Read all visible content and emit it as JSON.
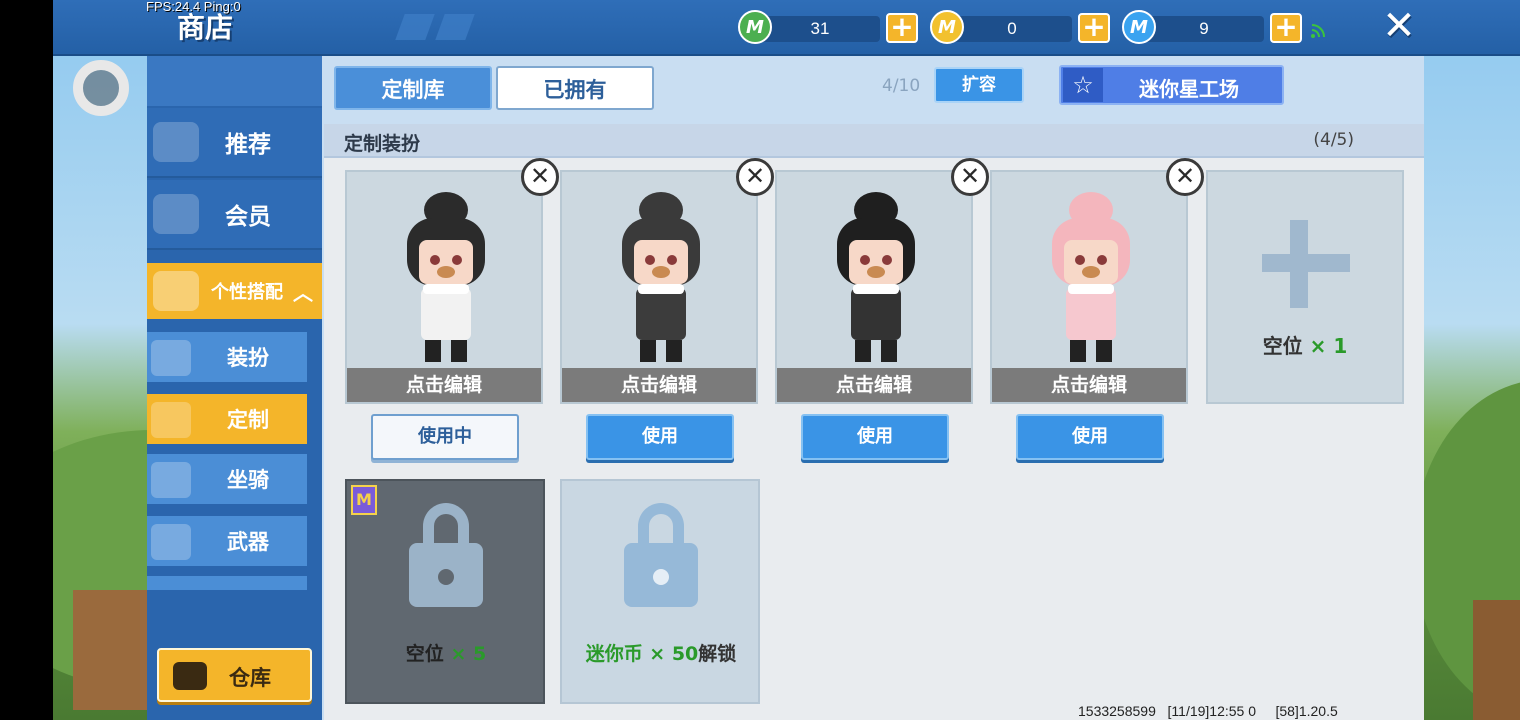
{
  "hud": {
    "fps": "FPS:24.4  Ping:0",
    "title": "商店"
  },
  "currencies": [
    {
      "icon": "green-gem-icon",
      "value": "31",
      "color": "#4caf50"
    },
    {
      "icon": "mini-coin-icon",
      "value": "0",
      "color": "#f2c12e"
    },
    {
      "icon": "mini-bean-icon",
      "value": "9",
      "color": "#3aa3f0"
    }
  ],
  "sidebar": {
    "items": [
      {
        "label": "推荐",
        "icon": "thumbs-up-icon"
      },
      {
        "label": "会员",
        "icon": "vip-icon"
      },
      {
        "label": "个性搭配",
        "icon": "trophy-icon"
      },
      {
        "label": "装扮",
        "icon": "shirt-icon"
      },
      {
        "label": "定制",
        "icon": "custom-icon"
      },
      {
        "label": "坐骑",
        "icon": "mount-icon"
      },
      {
        "label": "武器",
        "icon": "gun-icon"
      }
    ],
    "warehouse_label": "仓库"
  },
  "tabs": {
    "library": "定制库",
    "owned": "已拥有"
  },
  "capacity": "4/10",
  "expand_label": "扩容",
  "workshop_label": "迷你星工场",
  "section": {
    "title": "定制装扮",
    "count": "(4/5)"
  },
  "outfits": [
    {
      "edit_label": "点击编辑",
      "button": "使用中",
      "hair": "#2b2b2b",
      "outfit": "#f2f2f2",
      "in_use": true
    },
    {
      "edit_label": "点击编辑",
      "button": "使用",
      "hair": "#3a3a3a",
      "outfit": "#3c3c3c",
      "in_use": false
    },
    {
      "edit_label": "点击编辑",
      "button": "使用",
      "hair": "#1f1f1f",
      "outfit": "#333333",
      "in_use": false
    },
    {
      "edit_label": "点击编辑",
      "button": "使用",
      "hair": "#f4b6bd",
      "outfit": "#f6c8cf",
      "in_use": false
    }
  ],
  "empty_slot": {
    "label": "空位",
    "count": "× 1"
  },
  "locked": [
    {
      "label": "空位",
      "count": "× 5",
      "badge": "M"
    },
    {
      "prefix": "迷你币 × 50",
      "suffix": "解锁"
    }
  ],
  "footer": "1533258599   [11/19]12:55 0     [58]1.20.5",
  "colors": {
    "top_bar": "#2460a6",
    "accent_yellow": "#f4b52a",
    "button_blue": "#3a94e6"
  }
}
